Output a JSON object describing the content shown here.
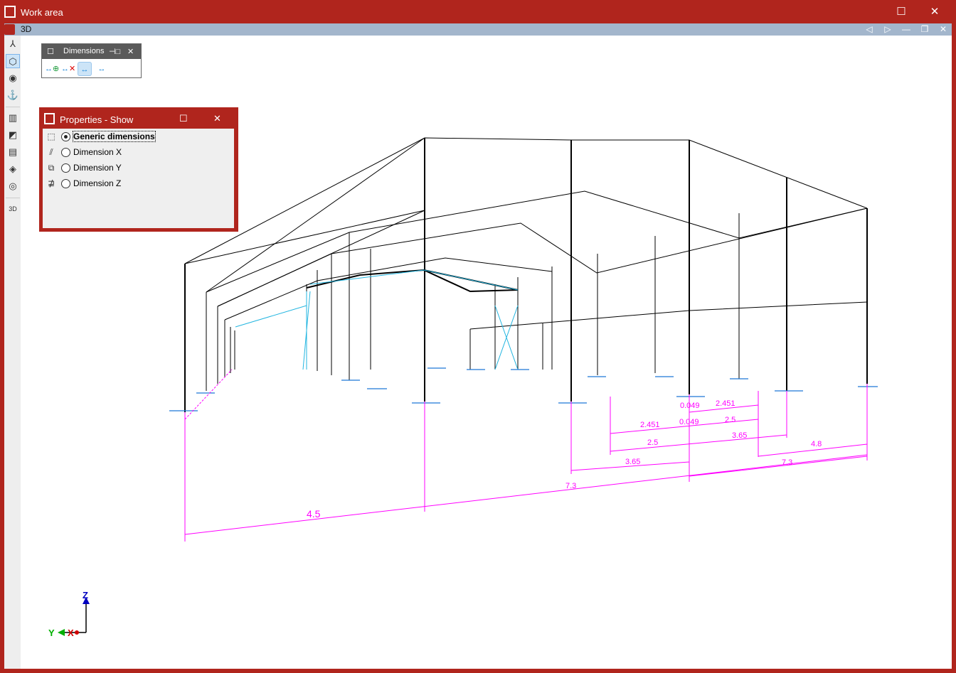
{
  "window": {
    "title": "Work area"
  },
  "view": {
    "title": "3D"
  },
  "dimensions_toolbar": {
    "title": "Dimensions",
    "buttons": [
      "add-dimension",
      "delete-dimension",
      "show-dimensions",
      "hide-dimensions"
    ]
  },
  "properties": {
    "title": "Properties - Show",
    "options": [
      {
        "label": "Generic dimensions",
        "selected": true
      },
      {
        "label": "Dimension X",
        "selected": false
      },
      {
        "label": "Dimension Y",
        "selected": false
      },
      {
        "label": "Dimension Z",
        "selected": false
      }
    ]
  },
  "dimension_labels": [
    "0.049",
    "2.451",
    "2.451",
    "0.049",
    "2.5",
    "2.5",
    "3.65",
    "3.65",
    "4.8",
    "7.3",
    "7.3",
    "4.5"
  ],
  "axes": {
    "z": "Z",
    "y": "Y",
    "x": "X"
  },
  "colors": {
    "titlebar": "#b0251d",
    "dimension": "#ff00ff",
    "support": "#1e78d8"
  }
}
